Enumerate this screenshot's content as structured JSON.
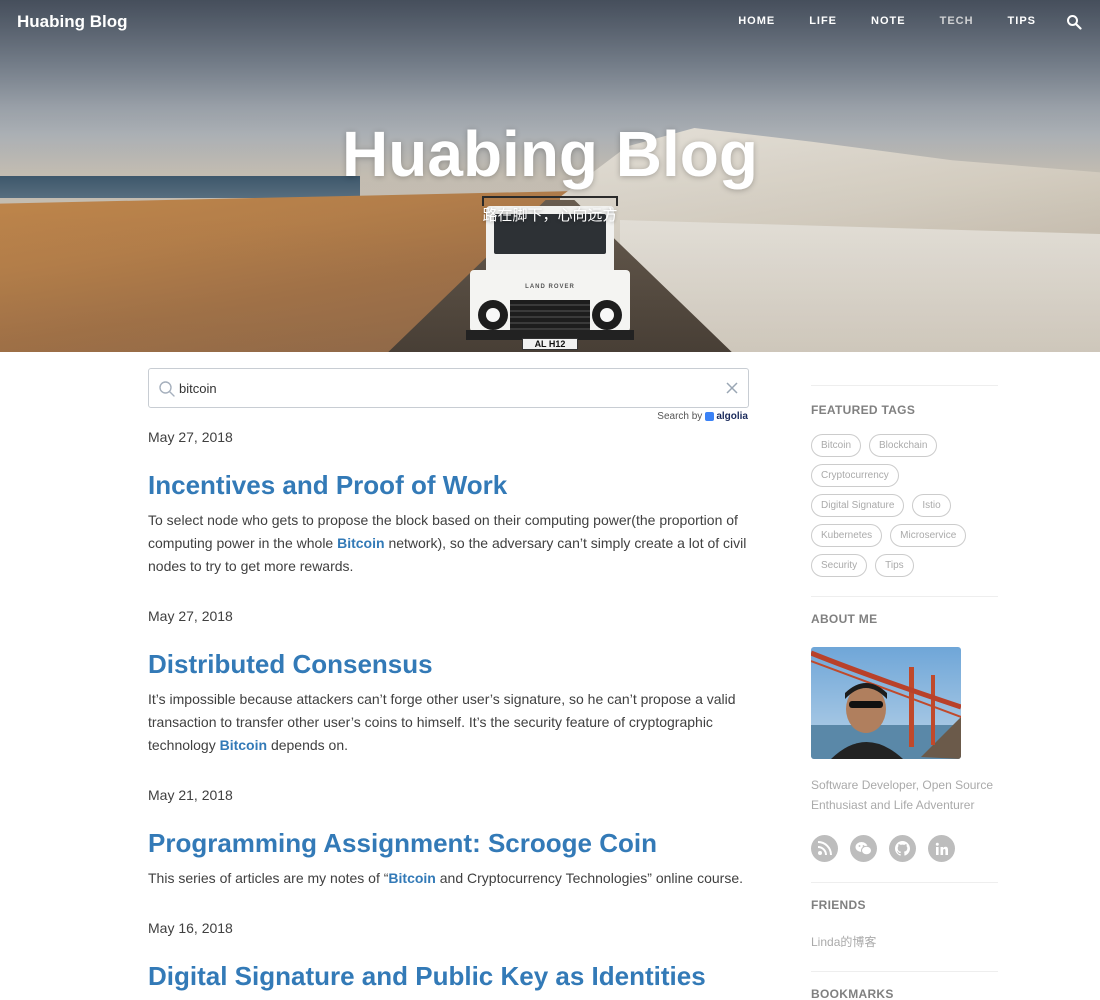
{
  "nav": {
    "brand": "Huabing Blog",
    "links": [
      "HOME",
      "LIFE",
      "NOTE",
      "TECH",
      "TIPS"
    ]
  },
  "hero": {
    "title": "Huabing Blog",
    "subtitle": "路在脚下，心向远方",
    "plate": "AL H12",
    "badge": "LAND ROVER"
  },
  "search": {
    "value": "bitcoin",
    "powered_by": "Search by",
    "provider": "algolia"
  },
  "posts": [
    {
      "date": "May 27, 2018",
      "title": "Incentives and Proof of Work",
      "excerpt_before": "To select node who gets to propose the block based on their computing power(the proportion of computing power in the whole ",
      "highlight": "Bitcoin",
      "excerpt_after": " network), so the adversary can’t simply create a lot of civil nodes to try to get more rewards."
    },
    {
      "date": "May 27, 2018",
      "title": "Distributed Consensus",
      "excerpt_before": "It’s impossible because attackers can’t forge other user’s signature, so he can’t propose a valid transaction to transfer other user’s coins to himself. It’s the security feature of cryptographic technology ",
      "highlight": "Bitcoin",
      "excerpt_after": " depends on."
    },
    {
      "date": "May 21, 2018",
      "title": "Programming Assignment: Scrooge Coin",
      "excerpt_before": "This series of articles are my notes of “",
      "highlight": "Bitcoin",
      "excerpt_after": " and Cryptocurrency Technologies” online course."
    },
    {
      "date": "May 16, 2018",
      "title": "Digital Signature and Public Key as Identities"
    }
  ],
  "sidebar": {
    "featured_tags_heading": "FEATURED TAGS",
    "tags": [
      "Bitcoin",
      "Blockchain",
      "Cryptocurrency",
      "Digital Signature",
      "Istio",
      "Kubernetes",
      "Microservice",
      "Security",
      "Tips"
    ],
    "about_heading": "ABOUT ME",
    "bio": "Software Developer, Open Source Enthusiast and Life Adventurer",
    "friends_heading": "FRIENDS",
    "friends": [
      "Linda的博客"
    ],
    "bookmarks_heading": "BOOKMARKS"
  },
  "colors": {
    "link_blue": "#337ab7",
    "muted_gray": "#aaaaaa",
    "social_gray": "#bdbdbd"
  },
  "icons": [
    "search-icon",
    "clear-icon",
    "rss-icon",
    "wechat-icon",
    "github-icon",
    "linkedin-icon"
  ]
}
